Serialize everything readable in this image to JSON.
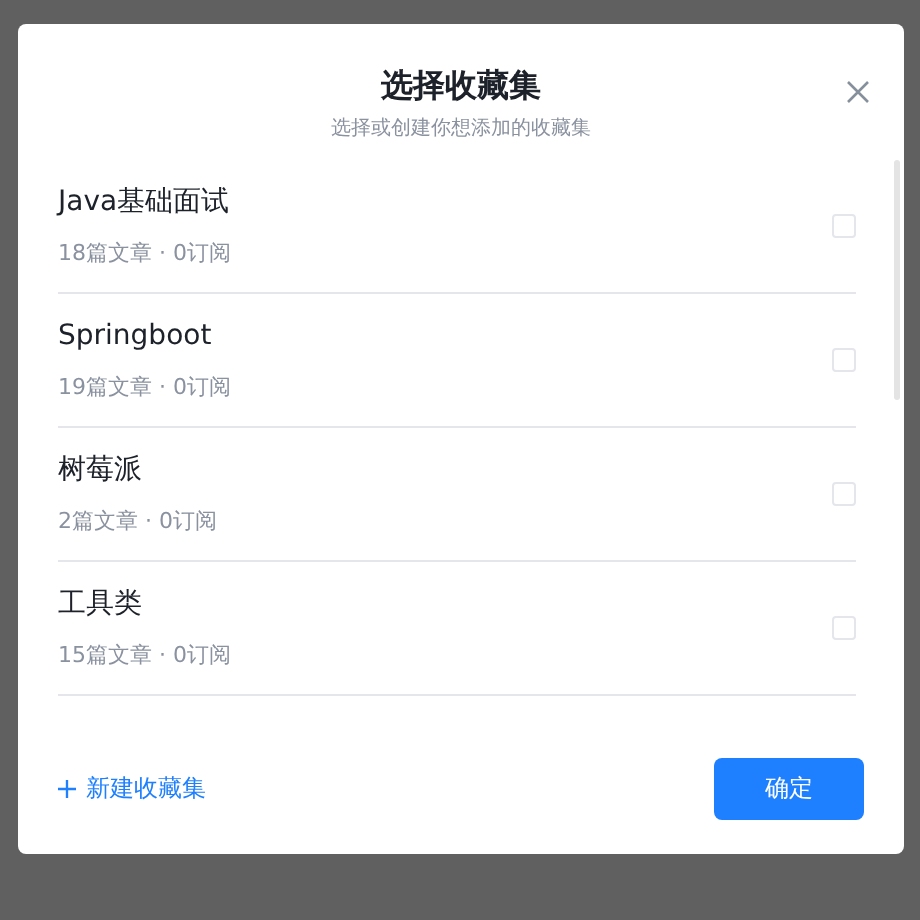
{
  "dialog": {
    "title": "选择收藏集",
    "subtitle": "选择或创建你想添加的收藏集"
  },
  "collections": [
    {
      "name": "Java基础面试",
      "meta": "18篇文章 · 0订阅",
      "checked": false
    },
    {
      "name": "Springboot",
      "meta": "19篇文章 · 0订阅",
      "checked": false
    },
    {
      "name": "树莓派",
      "meta": "2篇文章 · 0订阅",
      "checked": false
    },
    {
      "name": "工具类",
      "meta": "15篇文章 · 0订阅",
      "checked": false
    }
  ],
  "footer": {
    "new_collection": "新建收藏集",
    "confirm": "确定"
  }
}
